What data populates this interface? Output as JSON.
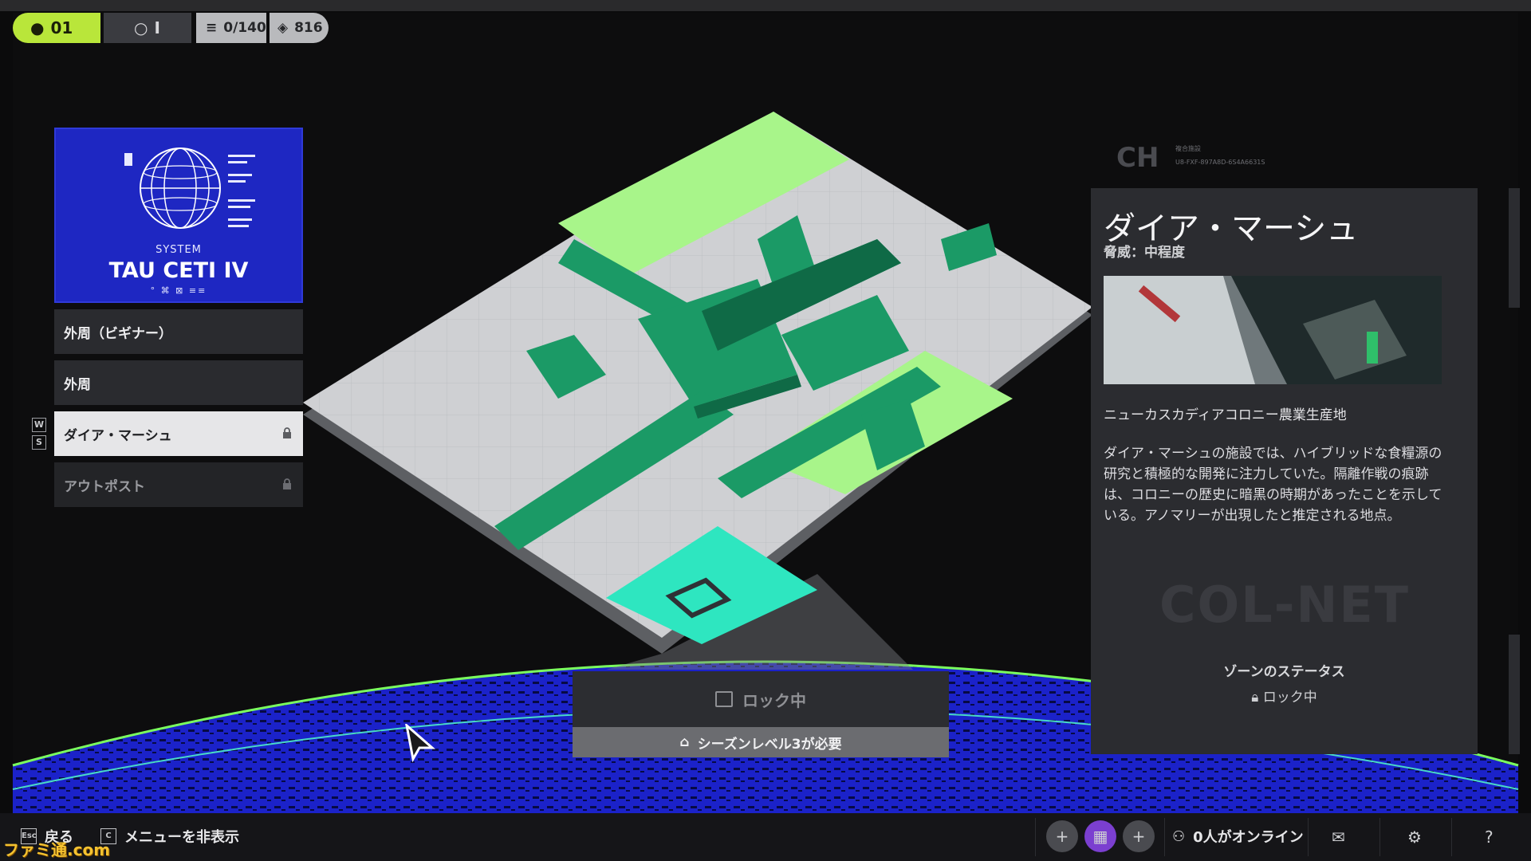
{
  "topbar": {
    "level": "01",
    "rank": "I",
    "resources": "0/140",
    "currency": "816"
  },
  "system": {
    "label": "SYSTEM",
    "name": "TAU CETI IV",
    "code": "° ⌘ ⊠ ≡≡"
  },
  "zones": [
    {
      "label": "外周（ビギナー）",
      "locked": false
    },
    {
      "label": "外周",
      "locked": false
    },
    {
      "label": "ダイア・マーシュ",
      "locked": true,
      "selected": true
    },
    {
      "label": "アウトポスト",
      "locked": true
    }
  ],
  "zone_keys": {
    "up": "W",
    "down": "S"
  },
  "info": {
    "title": "ダイア・マーシュ",
    "threat": "脅威：中程度",
    "subtitle": "ニューカスカディアコロニー農業生産地",
    "description": "ダイア・マーシュの施設では、ハイブリッドな食糧源の研究と積極的な開発に注力していた。隔離作戦の痕跡は、コロニーの歴史に暗黒の時期があったことを示している。アノマリーが出現したと推定される地点。",
    "watermark": "COL-NET",
    "status_title": "ゾーンのステータス",
    "status_value": "ロック中",
    "org_logo": "CH",
    "org_line1": "複合施設",
    "org_line2": "U8-FXF-897A8D-6S4A6631S"
  },
  "locked_box": {
    "label": "ロック中",
    "requirement": "シーズンレベル3が必要"
  },
  "bottombar": {
    "back_key": "Esc",
    "back_label": "戻る",
    "hide_key": "C",
    "hide_label": "メニューを非表示",
    "online_label": "0人がオンライン"
  },
  "watermark": "ファミ通.com",
  "colors": {
    "accent": "#b9e63a",
    "planet": "#1e27c2",
    "facility": "#1b9a66",
    "zone_highlight": "#a8f58a",
    "entry_tile": "#2ee6c0"
  }
}
